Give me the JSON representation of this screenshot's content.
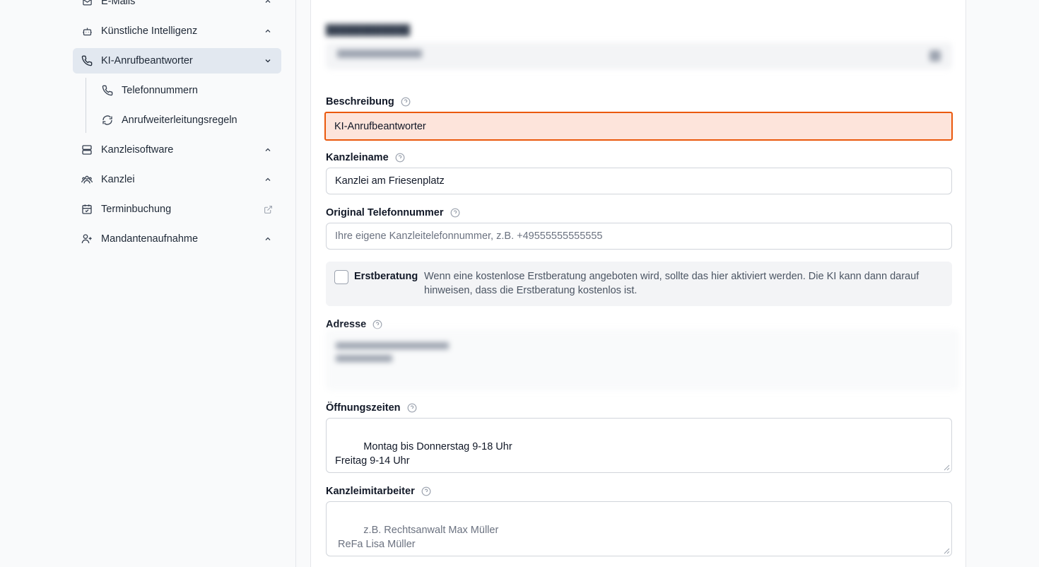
{
  "sidebar": {
    "items": [
      {
        "label": "E-Mails",
        "icon": "mail-icon"
      },
      {
        "label": "Künstliche Intelligenz",
        "icon": "robot-icon"
      },
      {
        "label": "KI-Anrufbeantworter",
        "icon": "phone-icon",
        "active": true
      },
      {
        "label": "Kanzleisoftware",
        "icon": "server-icon"
      },
      {
        "label": "Kanzlei",
        "icon": "users-icon"
      },
      {
        "label": "Terminbuchung",
        "icon": "calendar-check-icon"
      },
      {
        "label": "Mandantenaufnahme",
        "icon": "user-plus-icon"
      }
    ],
    "subitems": [
      {
        "label": "Telefonnummern",
        "icon": "phone-icon"
      },
      {
        "label": "Anrufweiterleitungsregeln",
        "icon": "refresh-icon"
      }
    ]
  },
  "form": {
    "beschreibung": {
      "label": "Beschreibung",
      "value": "KI-Anrufbeantworter"
    },
    "kanzleiname": {
      "label": "Kanzleiname",
      "value": "Kanzlei am Friesenplatz"
    },
    "telefon": {
      "label": "Original Telefonnummer",
      "placeholder": "Ihre eigene Kanzleitelefonnummer, z.B. +49555555555555"
    },
    "erstberatung": {
      "label": "Erstberatung",
      "description": "Wenn eine kostenlose Erstberatung angeboten wird, sollte das hier aktiviert werden. Die KI kann dann darauf hinweisen, dass die Erstberatung kostenlos ist.",
      "checked": false
    },
    "adresse": {
      "label": "Adresse"
    },
    "oeffnungszeiten": {
      "label": "Öffnungszeiten",
      "value": "Montag bis Donnerstag 9-18 Uhr\nFreitag 9-14 Uhr"
    },
    "mitarbeiter": {
      "label": "Kanzleimitarbeiter",
      "placeholder": "z.B. Rechtsanwalt Max Müller\n ReFa Lisa Müller"
    }
  },
  "colors": {
    "error_border": "#ea580c",
    "error_bg": "#fde4db",
    "active_nav": "#e2e8f0"
  }
}
